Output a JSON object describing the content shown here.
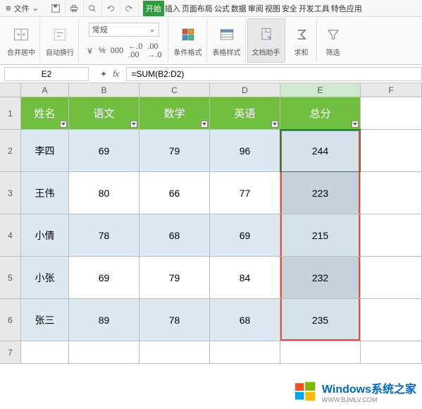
{
  "menubar": {
    "file_label": "文件",
    "tabs": [
      "开始",
      "插入",
      "页面布局",
      "公式",
      "数据",
      "审阅",
      "视图",
      "安全",
      "开发工具",
      "特色应用"
    ],
    "active_tab": 0
  },
  "ribbon": {
    "merge_label": "合并居中",
    "wrap_label": "自动换行",
    "number_format": "常规",
    "currency_symbol": "￥",
    "percent": "%",
    "comma": "000",
    "dec_inc": ".0",
    "dec_dec": ".00",
    "cond_format": "条件格式",
    "table_style": "表格样式",
    "doc_helper": "文档助手",
    "sum_label": "求和",
    "filter_label": "筛选"
  },
  "formula_bar": {
    "name_box": "E2",
    "formula": "=SUM(B2:D2)"
  },
  "sheet": {
    "col_labels": [
      "A",
      "B",
      "C",
      "D",
      "E",
      "F"
    ],
    "row_labels": [
      "1",
      "2",
      "3",
      "4",
      "5",
      "6",
      "7"
    ],
    "headers": [
      "姓名",
      "语文",
      "数学",
      "英语",
      "总分"
    ],
    "rows": [
      {
        "name": "李四",
        "chinese": 69,
        "math": 79,
        "english": 96,
        "total": 244
      },
      {
        "name": "王伟",
        "chinese": 80,
        "math": 66,
        "english": 77,
        "total": 223
      },
      {
        "name": "小倩",
        "chinese": 78,
        "math": 68,
        "english": 69,
        "total": 215
      },
      {
        "name": "小张",
        "chinese": 69,
        "math": 79,
        "english": 84,
        "total": 232
      },
      {
        "name": "张三",
        "chinese": 89,
        "math": 78,
        "english": 68,
        "total": 235
      }
    ],
    "active_cell_col": "E",
    "selection_box_row": 2
  },
  "watermark": {
    "text": "Windows系统之家",
    "url": "WWW.BJMLV.COM"
  }
}
